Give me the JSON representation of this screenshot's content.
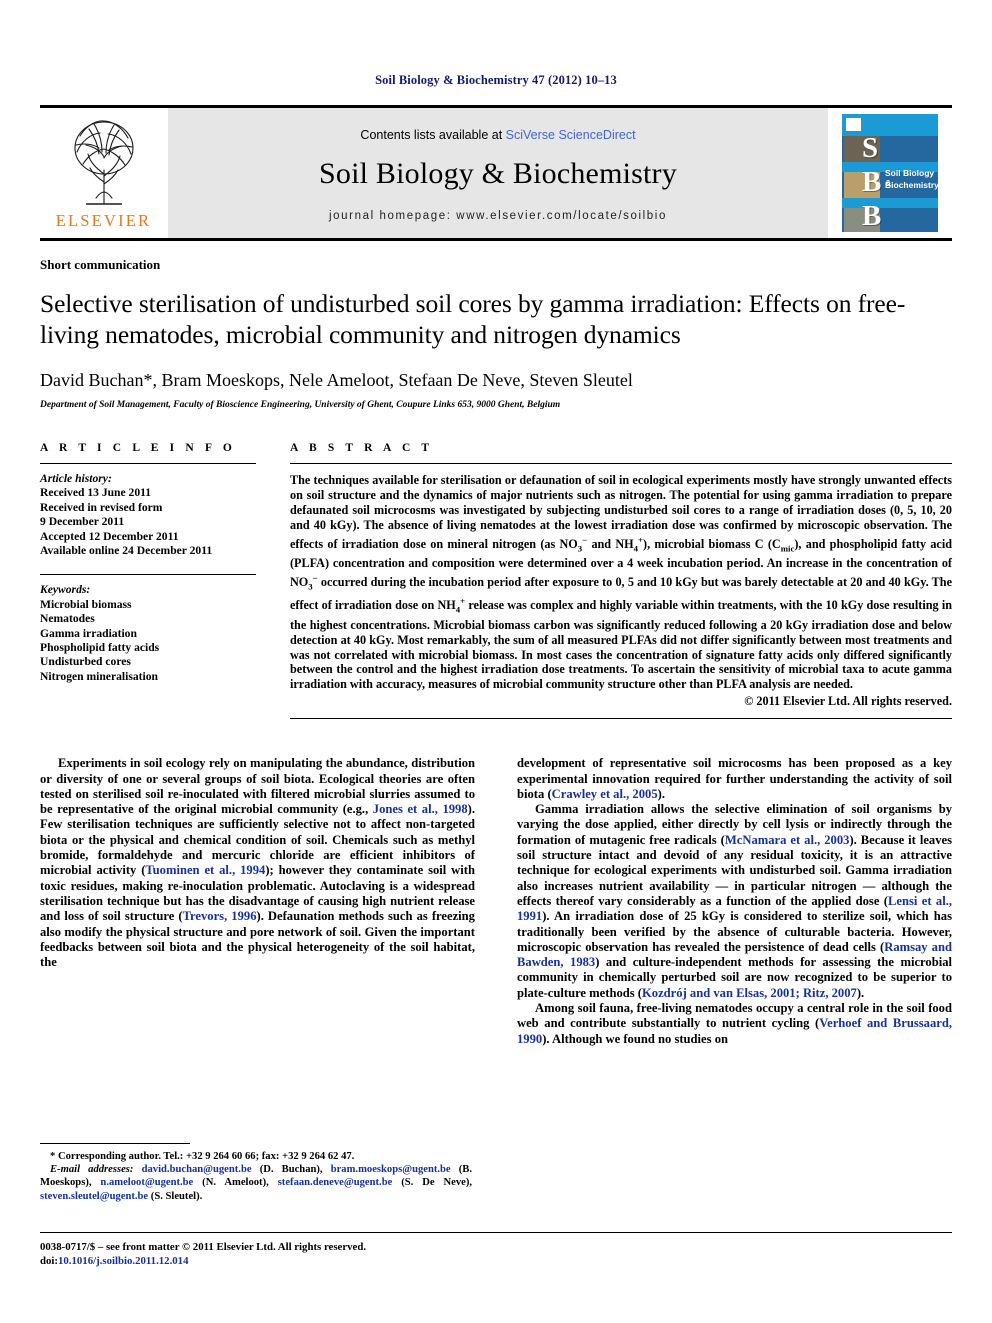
{
  "running_head": "Soil Biology & Biochemistry 47 (2012) 10–13",
  "masthead": {
    "publisher_name": "ELSEVIER",
    "contents_prefix": "Contents lists available at ",
    "contents_link": "SciVerse ScienceDirect",
    "journal_title": "Soil Biology & Biochemistry",
    "homepage": "journal homepage: www.elsevier.com/locate/soilbio",
    "cover": {
      "letters": [
        "S",
        "B",
        "B"
      ],
      "title_line1": "Soil Biology &",
      "title_line2": "Biochemistry",
      "background_color": "#1b9ad6"
    }
  },
  "article": {
    "category": "Short communication",
    "title": "Selective sterilisation of undisturbed soil cores by gamma irradiation: Effects on free-living nematodes, microbial community and nitrogen dynamics",
    "authors": "David Buchan*, Bram Moeskops, Nele Ameloot, Stefaan De Neve, Steven Sleutel",
    "affiliation": "Department of Soil Management, Faculty of Bioscience Engineering, University of Ghent, Coupure Links 653, 9000 Ghent, Belgium"
  },
  "article_info": {
    "heading": "A R T I C L E  I N F O",
    "history_label": "Article history:",
    "history": [
      "Received 13 June 2011",
      "Received in revised form",
      "9 December 2011",
      "Accepted 12 December 2011",
      "Available online 24 December 2011"
    ],
    "keywords_label": "Keywords:",
    "keywords": [
      "Microbial biomass",
      "Nematodes",
      "Gamma irradiation",
      "Phospholipid fatty acids",
      "Undisturbed cores",
      "Nitrogen mineralisation"
    ]
  },
  "abstract": {
    "heading": "A B S T R A C T",
    "copyright": "© 2011 Elsevier Ltd. All rights reserved."
  },
  "body": {
    "left_paragraph_1_pre_cite": "Experiments in soil ecology rely on manipulating the abundance, distribution or diversity of one or several groups of soil biota. Ecological theories are often tested on sterilised soil re-inoculated with filtered microbial slurries assumed to be representative of the original microbial community (e.g., ",
    "cite_jones": "Jones et al., 1998",
    "left_paragraph_1_mid": "). Few sterilisation techniques are sufficiently selective not to affect non-targeted biota or the physical and chemical condition of soil. Chemicals such as methyl bromide, formaldehyde and mercuric chloride are efficient inhibitors of microbial activity (",
    "cite_tuominen": "Tuominen et al., 1994",
    "left_paragraph_1_mid2": "); however they contaminate soil with toxic residues, making re-inoculation problematic. Autoclaving is a widespread sterilisation technique but has the disadvantage of causing high nutrient release and loss of soil structure (",
    "cite_trevors": "Trevors, 1996",
    "left_paragraph_1_end": "). Defaunation methods such as freezing also modify the physical structure and pore network of soil. Given the important feedbacks between soil biota and the physical heterogeneity of the soil habitat, the",
    "right_paragraph_1_pre": "development of representative soil microcosms has been proposed as a key experimental innovation required for further understanding the activity of soil biota (",
    "cite_crawley": "Crawley et al., 2005",
    "right_paragraph_1_end": ").",
    "right_paragraph_2_pre": "Gamma irradiation allows the selective elimination of soil organisms by varying the dose applied, either directly by cell lysis or indirectly through the formation of mutagenic free radicals (",
    "cite_mcnamara": "McNamara et al., 2003",
    "right_paragraph_2_mid": "). Because it leaves soil structure intact and devoid of any residual toxicity, it is an attractive technique for ecological experiments with undisturbed soil. Gamma irradiation also increases nutrient availability — in particular nitrogen — although the effects thereof vary considerably as a function of the applied dose (",
    "cite_lensi": "Lensi et al., 1991",
    "right_paragraph_2_mid2": "). An irradiation dose of 25 kGy is considered to sterilize soil, which has traditionally been verified by the absence of culturable bacteria. However, microscopic observation has revealed the persistence of dead cells (",
    "cite_ramsay": "Ramsay and Bawden, 1983",
    "right_paragraph_2_mid3": ") and culture-independent methods for assessing the microbial community in chemically perturbed soil are now recognized to be superior to plate-culture methods (",
    "cite_kozdroj": "Kozdrój and van Elsas, 2001; Ritz, 2007",
    "right_paragraph_2_end": ").",
    "right_paragraph_3_pre": "Among soil fauna, free-living nematodes occupy a central role in the soil food web and contribute substantially to nutrient cycling (",
    "cite_verhoef": "Verhoef and Brussaard, 1990",
    "right_paragraph_3_end": "). Although we found no studies on"
  },
  "footnote": {
    "corresponding": "* Corresponding author. Tel.: +32 9 264 60 66; fax: +32 9 264 62 47.",
    "email_label": "E-mail addresses:",
    "email_1": "david.buchan@ugent.be",
    "email_1_name": " (D. Buchan), ",
    "email_2": "bram.moeskops@ugent.be",
    "email_2_name": " (B. Moeskops), ",
    "email_3": "n.ameloot@ugent.be",
    "email_3_name": " (N. Ameloot), ",
    "email_4": "stefaan.deneve@ugent.be",
    "email_4_name": " (S. De Neve), ",
    "email_5": "steven.sleutel@ugent.be",
    "email_5_name": " (S. Sleutel)."
  },
  "footer": {
    "issn_line": "0038-0717/$ – see front matter © 2011 Elsevier Ltd. All rights reserved.",
    "doi_prefix": "doi:",
    "doi": "10.1016/j.soilbio.2011.12.014"
  },
  "colors": {
    "citation_blue": "#16309c",
    "elsevier_orange": "#e77817",
    "link_blue": "#4566c8",
    "runhead_navy": "#16196b"
  }
}
